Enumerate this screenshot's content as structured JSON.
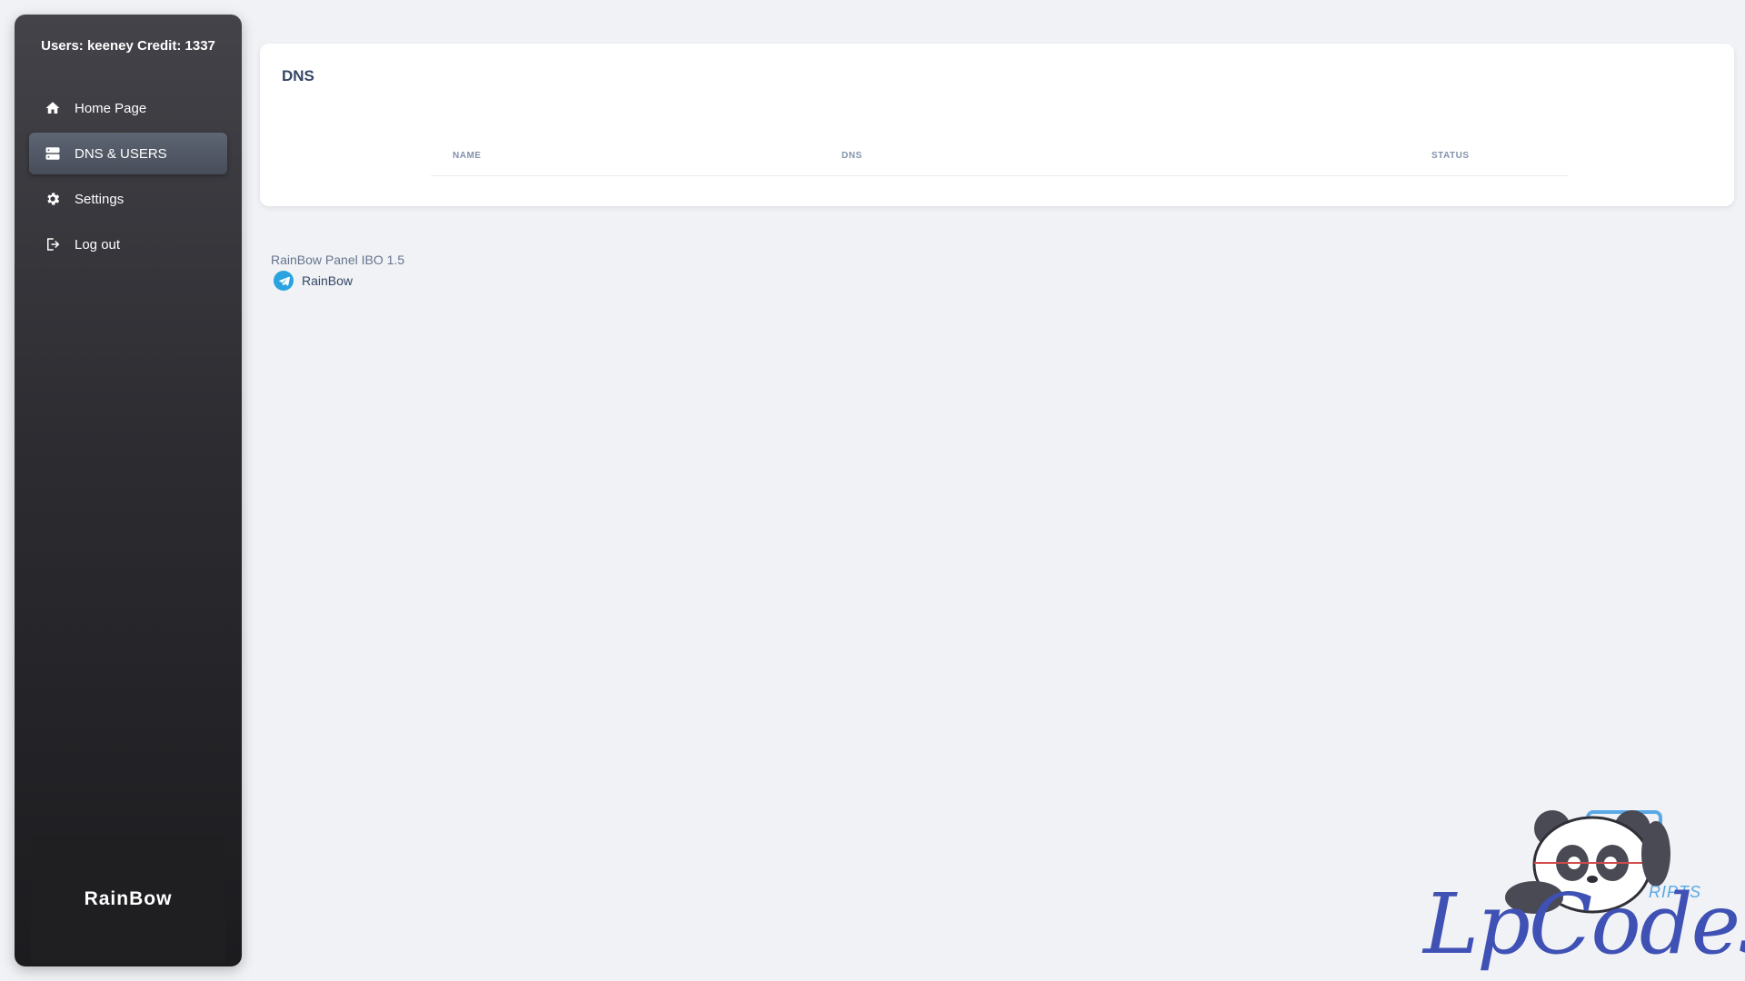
{
  "sidebar": {
    "user_info": "Users: keeney Credit: 1337",
    "items": [
      {
        "label": "Home Page",
        "icon": "home-icon"
      },
      {
        "label": "DNS & USERS",
        "icon": "server-icon",
        "active": true
      },
      {
        "label": "Settings",
        "icon": "gear-icon"
      },
      {
        "label": "Log out",
        "icon": "logout-icon"
      }
    ],
    "brand": "RainBow"
  },
  "card": {
    "title": "DNS",
    "columns": [
      "NAME",
      "DNS",
      "STATUS"
    ],
    "rows": []
  },
  "footer": {
    "version": "RainBow Panel IBO 1.5",
    "telegram_label": "RainBow",
    "telegram_icon": "telegram-icon"
  },
  "watermark": {
    "text": "LpCodes",
    "subtext": "RIPTS"
  },
  "colors": {
    "page_background": "#f0f2f5",
    "sidebar_top": "#434349",
    "sidebar_bottom": "#1c1c1f",
    "active_item": "#5e6573",
    "title_text": "#344767",
    "muted_text": "#8392ab",
    "telegram": "#2aa3df",
    "watermark": "#3f51b5"
  }
}
